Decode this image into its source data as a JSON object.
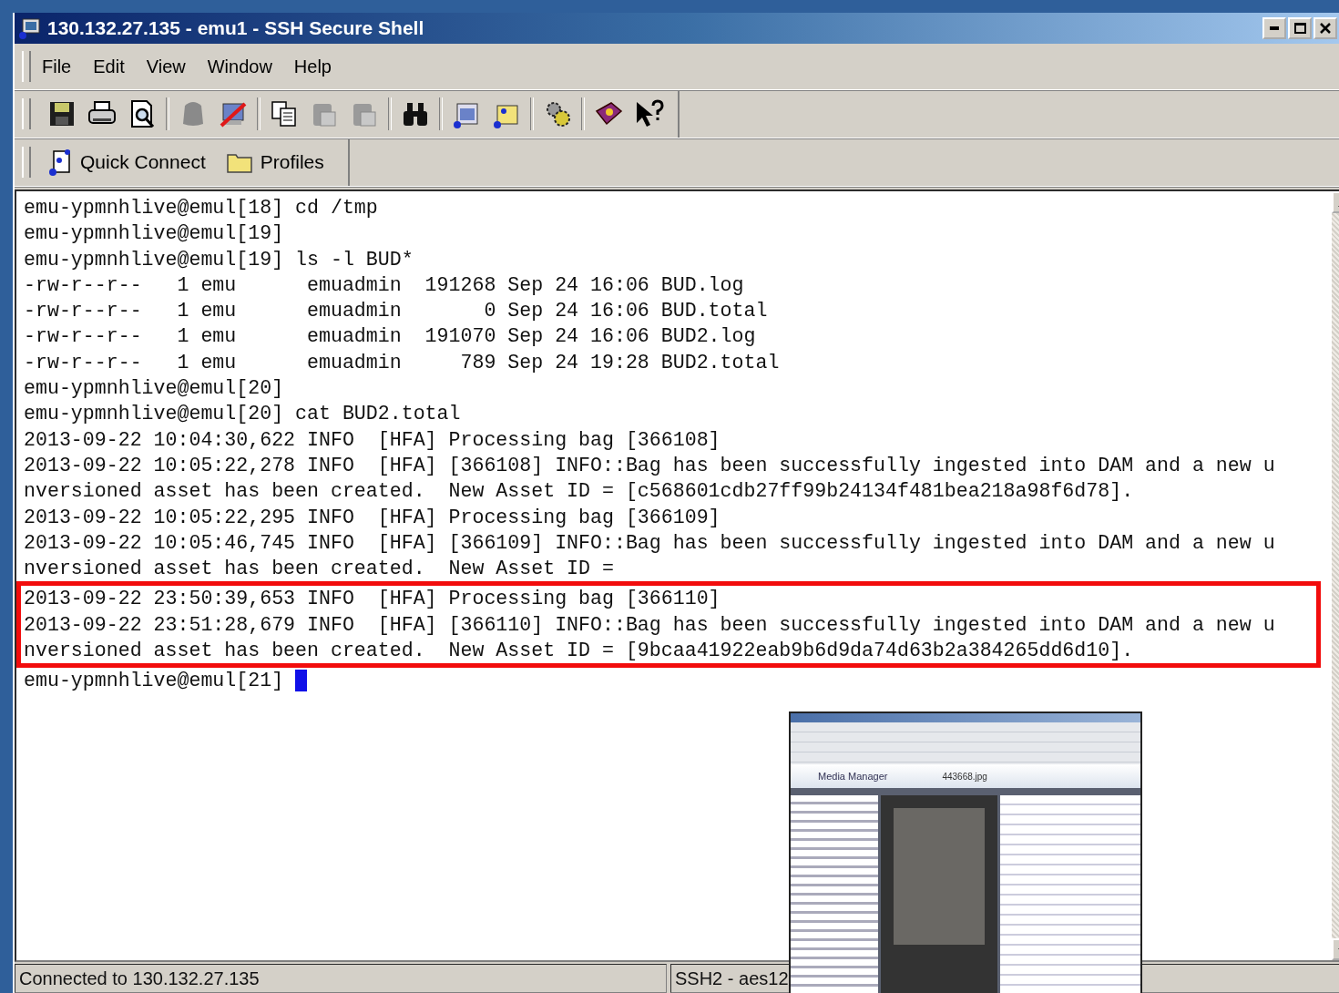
{
  "window": {
    "title": "130.132.27.135 - emu1 - SSH Secure Shell"
  },
  "menu": [
    "File",
    "Edit",
    "View",
    "Window",
    "Help"
  ],
  "quick_bar": [
    "Quick Connect",
    "Profiles"
  ],
  "terminal": {
    "lines": [
      "emu-ypmnhlive@emul[18] cd /tmp",
      "emu-ypmnhlive@emul[19]",
      "emu-ypmnhlive@emul[19] ls -l BUD*",
      "-rw-r--r--   1 emu      emuadmin  191268 Sep 24 16:06 BUD.log",
      "-rw-r--r--   1 emu      emuadmin       0 Sep 24 16:06 BUD.total",
      "-rw-r--r--   1 emu      emuadmin  191070 Sep 24 16:06 BUD2.log",
      "-rw-r--r--   1 emu      emuadmin     789 Sep 24 19:28 BUD2.total",
      "emu-ypmnhlive@emul[20]",
      "emu-ypmnhlive@emul[20] cat BUD2.total",
      "2013-09-22 10:04:30,622 INFO  [HFA] Processing bag [366108]",
      "2013-09-22 10:05:22,278 INFO  [HFA] [366108] INFO::Bag has been successfully ingested into DAM and a new u",
      "nversioned asset has been created.  New Asset ID = [c568601cdb27ff99b24134f481bea218a98f6d78].",
      "2013-09-22 10:05:22,295 INFO  [HFA] Processing bag [366109]",
      "2013-09-22 10:05:46,745 INFO  [HFA] [366109] INFO::Bag has been successfully ingested into DAM and a new u",
      "nversioned asset has been created.  New Asset ID ="
    ],
    "highlighted_lines": [
      "2013-09-22 23:50:39,653 INFO  [HFA] Processing bag [366110]",
      "2013-09-22 23:51:28,679 INFO  [HFA] [366110] INFO::Bag has been successfully ingested into DAM and a new u",
      "nversioned asset has been created.  New Asset ID = [9bcaa41922eab9b6d9da74d63b2a384265dd6d10]."
    ],
    "prompt": "emu-ypmnhlive@emul[21]"
  },
  "status_bar": [
    "Connected to 130.132.27.135",
    "SSH2 - aes12"
  ],
  "inset_screenshot": {
    "app_title": "Media Manager",
    "file_name": "443668.jpg"
  }
}
